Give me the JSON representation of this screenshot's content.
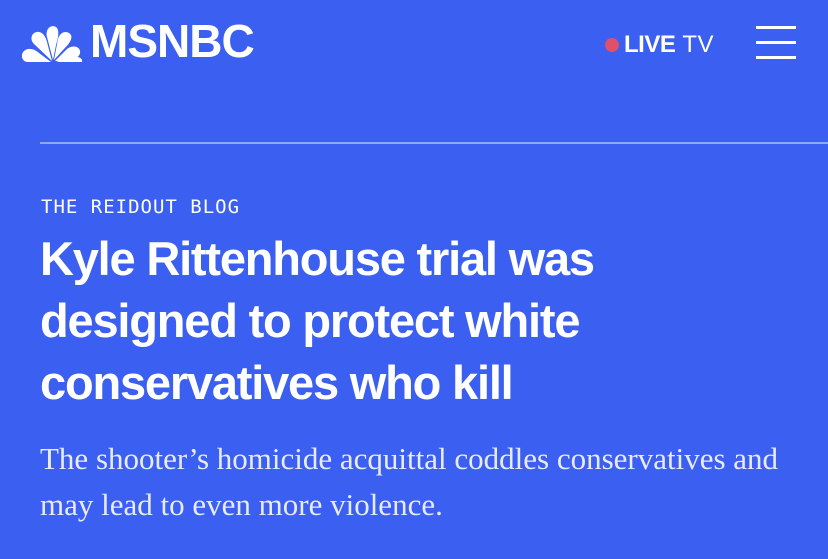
{
  "header": {
    "logo_text": "MSNBC",
    "live_label": "LIVE",
    "tv_label": "TV",
    "live_dot_color": "#e0506b",
    "menu_icon": "hamburger-menu-icon"
  },
  "article": {
    "kicker": "THE REIDOUT BLOG",
    "headline": "Kyle Rittenhouse trial was designed to protect white conservatives who kill",
    "dek": "The shooter’s homicide acquittal coddles conservatives and may lead to even more violence."
  },
  "colors": {
    "background": "#3b5ff0",
    "text": "#ffffff"
  }
}
